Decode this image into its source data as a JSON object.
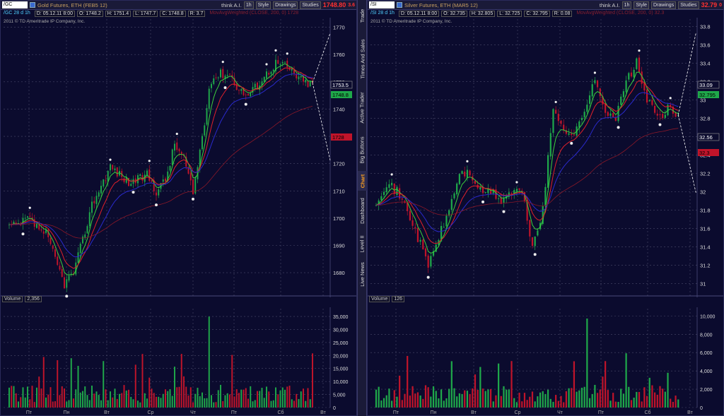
{
  "colors": {
    "bg": "#0b0b2e",
    "bull": "#1fa84a",
    "bear": "#c0142a",
    "grid": "#4a4a6a",
    "ema_fast": "#3cd03c",
    "ema_mid": "#e0202a",
    "ema_slow": "#2a2acc",
    "ema_long": "#8a1828",
    "last_red": "#ff3030"
  },
  "side_tabs": [
    "Trade",
    "Times And Sales",
    "Active Trader",
    "Big Buttons",
    "Chart",
    "Dashboard",
    "Level II",
    "Live News"
  ],
  "active_tab": "Chart",
  "charts": [
    {
      "toolbar": {
        "symbol": "/GC",
        "name": "Gold Futures, ETH (FEB5 12)",
        "think": "think A.I.",
        "timeframe": "1h",
        "style": "Style",
        "drawings": "Drawings",
        "studies": "Studies",
        "last": "1748.80",
        "change": "3.6"
      },
      "quote": {
        "symbol": "/GC 28 d 1h",
        "date": "D: 05.12.11 8:00",
        "open": "O: 1748.2",
        "high": "H: 1751.4",
        "low": "L: 1747.7",
        "close": "C: 1748.8",
        "range": "R: 3.7",
        "study": "MovAvgWeighted (CLOSE, 200, 0) 1728"
      },
      "copyright": "2011 © TD Ameritrade IP Company, Inc.",
      "volume_label": "Volume",
      "volume_value": "2,356",
      "price_ticks": [
        "1770",
        "1760",
        "1750",
        "1740",
        "1730",
        "1720",
        "1710",
        "1700",
        "1690",
        "1680"
      ],
      "price_range": [
        1672,
        1773
      ],
      "price_labels": [
        {
          "text": "1753.5",
          "color": "#dddddd"
        },
        {
          "text": "1748.8",
          "color": "#1fa84a"
        },
        {
          "text": "1728",
          "color": "#c0142a"
        }
      ],
      "vol_ticks": [
        "35,000",
        "30,000",
        "25,000",
        "20,000",
        "15,000",
        "10,000",
        "5,000",
        "0"
      ],
      "vol_max": 38000,
      "days": [
        "Пт",
        "Пн",
        "Вт",
        "Ср",
        "Чт",
        "Пт",
        "Сб",
        "Вт"
      ]
    },
    {
      "toolbar": {
        "symbol": "/SI",
        "name": "Silver Futures, ETH (MAR5 12)",
        "think": "think A.I.",
        "timeframe": "1h",
        "style": "Style",
        "drawings": "Drawings",
        "studies": "Studies",
        "last": "32.79",
        "change": "0"
      },
      "quote": {
        "symbol": "/SI 28 d 1h",
        "date": "D: 05.12.11 8:00",
        "open": "O: 32.735",
        "high": "H: 32.805",
        "low": "L: 32.725",
        "close": "C: 32.795",
        "range": "R: 0.08",
        "study": "MovAvgWeighted (CLOSE, 200, 0) 32.3"
      },
      "copyright": "2011 © TD Ameritrade IP Company, Inc.",
      "volume_label": "Volume",
      "volume_value": "126",
      "price_ticks": [
        "33.8",
        "33.6",
        "33.4",
        "33.2",
        "33",
        "32.8",
        "32.6",
        "32.4",
        "32.2",
        "32",
        "31.8",
        "31.6",
        "31.4",
        "31.2",
        "31"
      ],
      "price_range": [
        30.88,
        33.88
      ],
      "price_labels": [
        {
          "text": "33.09",
          "color": "#dddddd"
        },
        {
          "text": "32.795",
          "color": "#1fa84a"
        },
        {
          "text": "32.56",
          "color": "#dddddd"
        },
        {
          "text": "32.3",
          "color": "#c0142a"
        }
      ],
      "vol_ticks": [
        "10,000",
        "8,000",
        "6,000",
        "4,000",
        "2,000",
        "0"
      ],
      "vol_max": 10800,
      "days": [
        "Пт",
        "Пн",
        "Вт",
        "Ср",
        "Чт",
        "Пт",
        "Сб",
        "Вт"
      ]
    }
  ],
  "chart_data": [
    {
      "type": "candlestick",
      "title": "Gold Futures, ETH (FEB5 12)",
      "timeframe": "1h",
      "ylim": [
        1672,
        1773
      ],
      "close_path": [
        [
          0,
          1697
        ],
        [
          4,
          1697
        ],
        [
          8,
          1700
        ],
        [
          12,
          1697
        ],
        [
          16,
          1694
        ],
        [
          20,
          1685
        ],
        [
          24,
          1676
        ],
        [
          28,
          1680
        ],
        [
          32,
          1692
        ],
        [
          36,
          1705
        ],
        [
          40,
          1712
        ],
        [
          44,
          1719
        ],
        [
          48,
          1716
        ],
        [
          52,
          1713
        ],
        [
          56,
          1714
        ],
        [
          60,
          1716
        ],
        [
          64,
          1710
        ],
        [
          68,
          1714
        ],
        [
          72,
          1727
        ],
        [
          76,
          1722
        ],
        [
          80,
          1709
        ],
        [
          84,
          1730
        ],
        [
          88,
          1751
        ],
        [
          92,
          1753
        ],
        [
          96,
          1753
        ],
        [
          100,
          1747
        ],
        [
          104,
          1745
        ],
        [
          108,
          1749
        ],
        [
          112,
          1753
        ],
        [
          116,
          1757
        ],
        [
          120,
          1756
        ],
        [
          124,
          1753
        ],
        [
          128,
          1750
        ],
        [
          132,
          1749
        ]
      ],
      "volume_max": 35000
    },
    {
      "type": "candlestick",
      "title": "Silver Futures, ETH (MAR5 12)",
      "timeframe": "1h",
      "ylim": [
        30.88,
        33.88
      ],
      "close_path": [
        [
          0,
          31.9
        ],
        [
          4,
          32.1
        ],
        [
          8,
          32.0
        ],
        [
          12,
          31.8
        ],
        [
          16,
          31.5
        ],
        [
          20,
          31.2
        ],
        [
          24,
          31.5
        ],
        [
          28,
          31.8
        ],
        [
          32,
          32.2
        ],
        [
          36,
          32.2
        ],
        [
          40,
          32.0
        ],
        [
          44,
          32.0
        ],
        [
          48,
          31.9
        ],
        [
          52,
          32.0
        ],
        [
          56,
          32.0
        ],
        [
          60,
          31.4
        ],
        [
          64,
          31.8
        ],
        [
          68,
          32.9
        ],
        [
          72,
          32.7
        ],
        [
          76,
          32.6
        ],
        [
          80,
          32.9
        ],
        [
          84,
          33.2
        ],
        [
          88,
          32.9
        ],
        [
          92,
          32.8
        ],
        [
          96,
          33.2
        ],
        [
          100,
          33.4
        ],
        [
          104,
          33.0
        ],
        [
          108,
          32.8
        ],
        [
          112,
          32.9
        ],
        [
          116,
          32.8
        ]
      ],
      "volume_max": 10000
    }
  ]
}
